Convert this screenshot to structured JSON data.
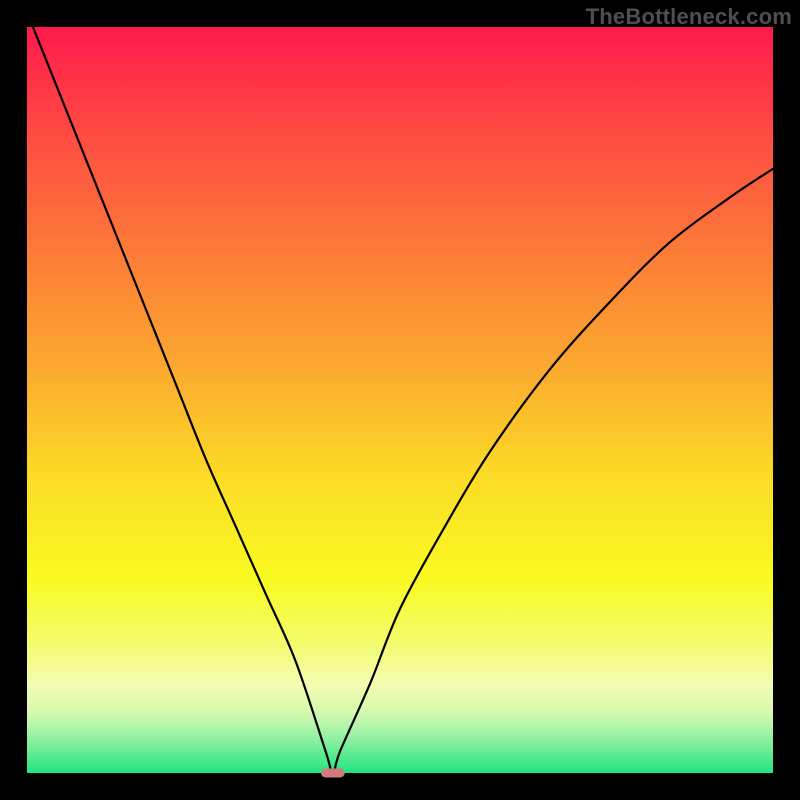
{
  "watermark": "TheBottleneck.com",
  "colors": {
    "frame": "#000000",
    "curve": "#000000",
    "marker": "#d47a7a",
    "gradient_stops": [
      {
        "pct": 0,
        "color": "#fe1a4c"
      },
      {
        "pct": 14,
        "color": "#fe4a42"
      },
      {
        "pct": 30,
        "color": "#fc7a38"
      },
      {
        "pct": 46,
        "color": "#fbaa2f"
      },
      {
        "pct": 60,
        "color": "#fbda26"
      },
      {
        "pct": 74,
        "color": "#f9fa21"
      },
      {
        "pct": 82,
        "color": "#f3fb66"
      },
      {
        "pct": 88,
        "color": "#f4fcb0"
      },
      {
        "pct": 92,
        "color": "#d3f9ae"
      },
      {
        "pct": 95,
        "color": "#99f1a5"
      },
      {
        "pct": 100,
        "color": "#1fe47e"
      }
    ]
  },
  "chart_data": {
    "type": "line",
    "title": "",
    "xlabel": "",
    "ylabel": "",
    "xlim": [
      0,
      100
    ],
    "ylim": [
      0,
      100
    ],
    "curve_min_x": 41,
    "marker": {
      "x": 41,
      "y": 0,
      "width": 3.2,
      "height": 1.2
    },
    "series": [
      {
        "name": "bottleneck-curve",
        "x": [
          0,
          4,
          8,
          12,
          16,
          20,
          24,
          28,
          32,
          36,
          40,
          41,
          42,
          46,
          50,
          56,
          62,
          70,
          78,
          86,
          94,
          100
        ],
        "y": [
          102,
          92,
          82,
          72,
          62,
          52,
          42,
          33,
          24,
          15,
          3,
          0,
          3,
          12,
          22,
          33,
          43,
          54,
          63,
          71,
          77,
          81
        ]
      }
    ]
  }
}
